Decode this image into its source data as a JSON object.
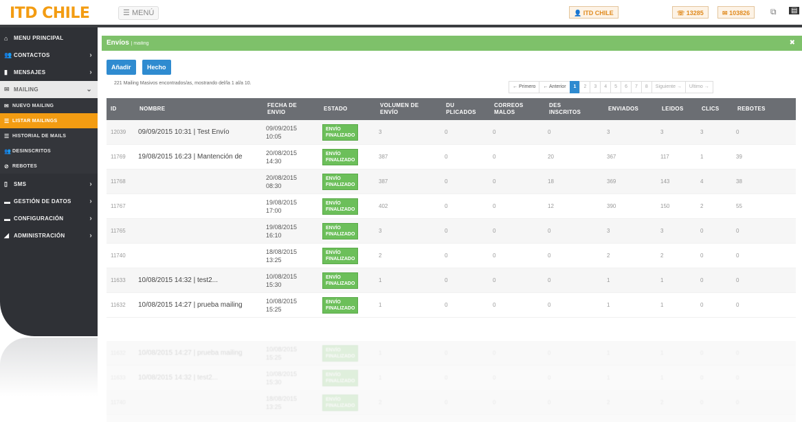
{
  "header": {
    "logo": "ITD CHILE",
    "menu_label": "MENÚ",
    "user_chip": "ITD CHILE",
    "phone_chip": "13285",
    "credit_chip": "103826"
  },
  "sidebar": {
    "items": [
      {
        "label": "MENU PRINCIPAL",
        "icon": "home-icon"
      },
      {
        "label": "CONTACTOS",
        "icon": "users-icon",
        "chevron": "›"
      },
      {
        "label": "MENSAJES",
        "icon": "file-icon",
        "chevron": "›"
      },
      {
        "label": "MAILING",
        "icon": "mail-icon",
        "chevron": "⌄"
      }
    ],
    "mailing_sub": [
      {
        "label": "NUEVO MAILING",
        "icon": "mail-icon"
      },
      {
        "label": "LISTAR MAILINGS",
        "icon": "list-icon"
      },
      {
        "label": "HISTORIAL DE MAILS",
        "icon": "list-icon"
      },
      {
        "label": "DESINSCRITOS",
        "icon": "users-icon"
      },
      {
        "label": "REBOTES",
        "icon": "ban-icon"
      }
    ],
    "more_items": [
      {
        "label": "SMS",
        "icon": "mobile-icon",
        "chevron": "›"
      },
      {
        "label": "GESTIÓN DE DATOS",
        "icon": "comment-icon",
        "chevron": "›"
      },
      {
        "label": "CONFIGURACIÓN",
        "icon": "comment-icon",
        "chevron": "›"
      },
      {
        "label": "ADMINISTRACIÓN",
        "icon": "chart-icon",
        "chevron": "›"
      }
    ]
  },
  "panel": {
    "title": "Envíos",
    "subtitle": "| mailing",
    "close_icon": "✖"
  },
  "toolbar": {
    "add_label": "Añadir",
    "done_label": "Hecho"
  },
  "summary": "221 Mailing Masivos encontrados/as, mostrando del/la 1 al/a 10.",
  "pager": {
    "first": "← Primero",
    "prev": "← Anterior",
    "pages": [
      "1",
      "2",
      "3",
      "4",
      "5",
      "6",
      "7",
      "8"
    ],
    "current": "1",
    "next": "Siguiente →",
    "last": "Ultimo →"
  },
  "table": {
    "headers": {
      "id": "ID",
      "nombre": "NOMBRE",
      "fecha": [
        "FECHA DE",
        "ENVIO"
      ],
      "estado": "ESTADO",
      "volumen": [
        "VOLUMEN DE",
        "ENVÍO"
      ],
      "duplicados": [
        "DU",
        "PLICADOS"
      ],
      "correos": [
        "CORREOS",
        "MALOS"
      ],
      "desinscritos": [
        "DES",
        "INSCRITOS"
      ],
      "enviados": "ENVIADOS",
      "leidos": "LEIDOS",
      "clics": "CLICS",
      "rebotes": "REBOTES"
    },
    "status_label": "ENVÍO FINALIZADO",
    "rows": [
      {
        "id": "12039",
        "nombre": "09/09/2015 10:31 | Test Envío",
        "fecha": "09/09/2015 10:05",
        "volumen": "3",
        "dup": "0",
        "cor": "0",
        "des": "0",
        "env": "3",
        "lei": "3",
        "cli": "3",
        "reb": "0"
      },
      {
        "id": "11769",
        "nombre": "19/08/2015 16:23 | Mantención de",
        "fecha": "20/08/2015 14:30",
        "volumen": "387",
        "dup": "0",
        "cor": "0",
        "des": "20",
        "env": "367",
        "lei": "117",
        "cli": "1",
        "reb": "39"
      },
      {
        "id": "11768",
        "nombre": "",
        "fecha": "20/08/2015 08:30",
        "volumen": "387",
        "dup": "0",
        "cor": "0",
        "des": "18",
        "env": "369",
        "lei": "143",
        "cli": "4",
        "reb": "38"
      },
      {
        "id": "11767",
        "nombre": "",
        "fecha": "19/08/2015 17:00",
        "volumen": "402",
        "dup": "0",
        "cor": "0",
        "des": "12",
        "env": "390",
        "lei": "150",
        "cli": "2",
        "reb": "55"
      },
      {
        "id": "11765",
        "nombre": "",
        "fecha": "19/08/2015 16:10",
        "volumen": "3",
        "dup": "0",
        "cor": "0",
        "des": "0",
        "env": "3",
        "lei": "3",
        "cli": "0",
        "reb": "0"
      },
      {
        "id": "11740",
        "nombre": "",
        "fecha": "18/08/2015 13:25",
        "volumen": "2",
        "dup": "0",
        "cor": "0",
        "des": "0",
        "env": "2",
        "lei": "2",
        "cli": "0",
        "reb": "0"
      },
      {
        "id": "11633",
        "nombre": "10/08/2015 14:32 | test2...",
        "fecha": "10/08/2015 15:30",
        "volumen": "1",
        "dup": "0",
        "cor": "0",
        "des": "0",
        "env": "1",
        "lei": "1",
        "cli": "0",
        "reb": "0"
      },
      {
        "id": "11632",
        "nombre": "10/08/2015 14:27 | prueba mailing",
        "fecha": "10/08/2015 15:25",
        "volumen": "1",
        "dup": "0",
        "cor": "0",
        "des": "0",
        "env": "1",
        "lei": "1",
        "cli": "0",
        "reb": "0"
      }
    ]
  },
  "colors": {
    "accent_orange": "#f39c12",
    "panel_green": "#7ec16a",
    "button_blue": "#2f8bd0",
    "sidebar_dark": "#2f3136",
    "status_green": "#6cbf5a"
  }
}
